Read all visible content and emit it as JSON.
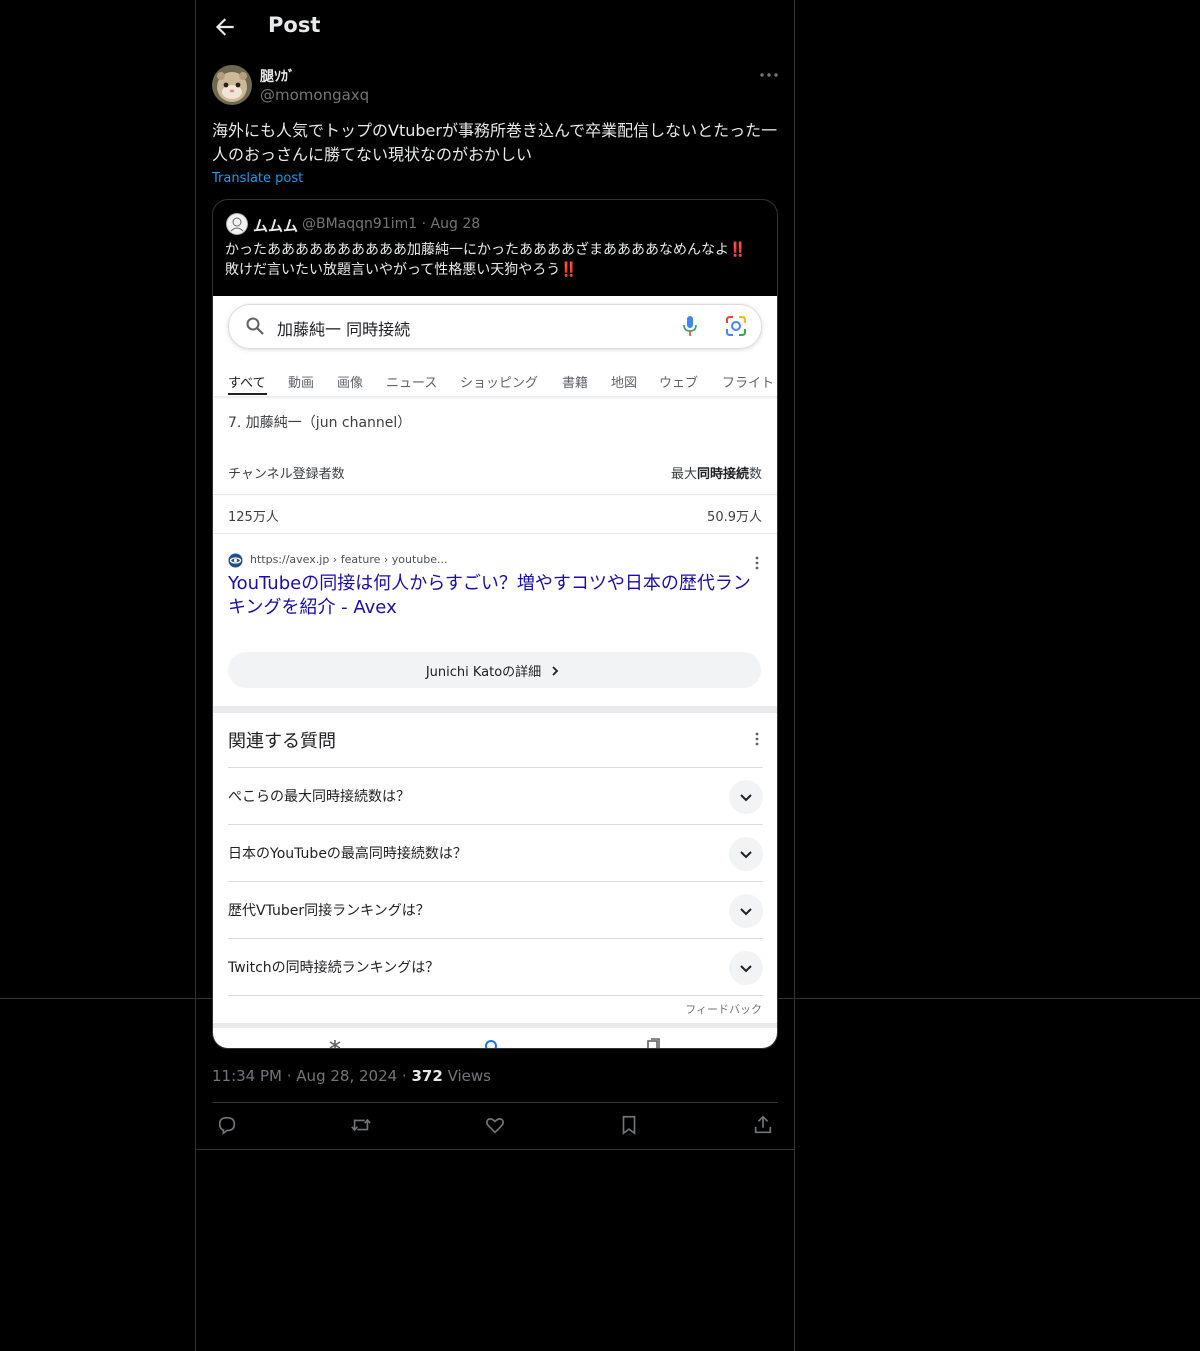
{
  "header": {
    "title": "Post"
  },
  "post": {
    "display_name": "腿ｿｶﾞ",
    "handle": "@momongaxq",
    "text": "海外にも人気でトップのVtuberが事務所巻き込んで卒業配信しないとたった一人のおっさんに勝てない現状なのがおかしい",
    "translate_label": "Translate post",
    "time": "11:34 PM",
    "date": "Aug 28, 2024",
    "views_count": "372",
    "views_label": "Views"
  },
  "quote": {
    "display_name": "ムムム",
    "handle": "@BMaqqn91im1",
    "date": "Aug 28",
    "line1": "かったああああああああああ加藤純一にかったああああざまああああなめんなよ",
    "line2": "敗けだ言いたい放題言いやがって性格悪い天狗やろう",
    "emphasis": "‼️",
    "screenshot": {
      "search_query": "加藤純一 同時接続",
      "tabs": [
        "すべて",
        "動画",
        "画像",
        "ニュース",
        "ショッピング",
        "書籍",
        "地図",
        "ウェブ",
        "フライト"
      ],
      "result_title": "7. 加藤純一（jun channel）",
      "table_header_left": "チャンネル登録者数",
      "table_header_right_prefix": "最大",
      "table_header_right_bold": "同時接続",
      "table_header_right_suffix": "数",
      "table_value_left": "125万人",
      "table_value_right": "50.9万人",
      "url": "https://avex.jp › feature › youtube...",
      "link_title": "YouTubeの同接は何人からすごい？増やすコツや日本の歴代ランキングを紹介 - Avex",
      "detail_button": "Junichi Katoの詳細",
      "related_title": "関連する質問",
      "questions": [
        "ぺこらの最大同時接続数は？",
        "日本のYouTubeの最高同時接続数は？",
        "歴代VTuber同接ランキングは？",
        "Twitchの同時接続ランキングは？"
      ],
      "feedback": "フィードバック"
    }
  },
  "colors": {
    "accent": "#1d9bf0",
    "link": "#1a0dab",
    "bang": "#f4212e"
  }
}
